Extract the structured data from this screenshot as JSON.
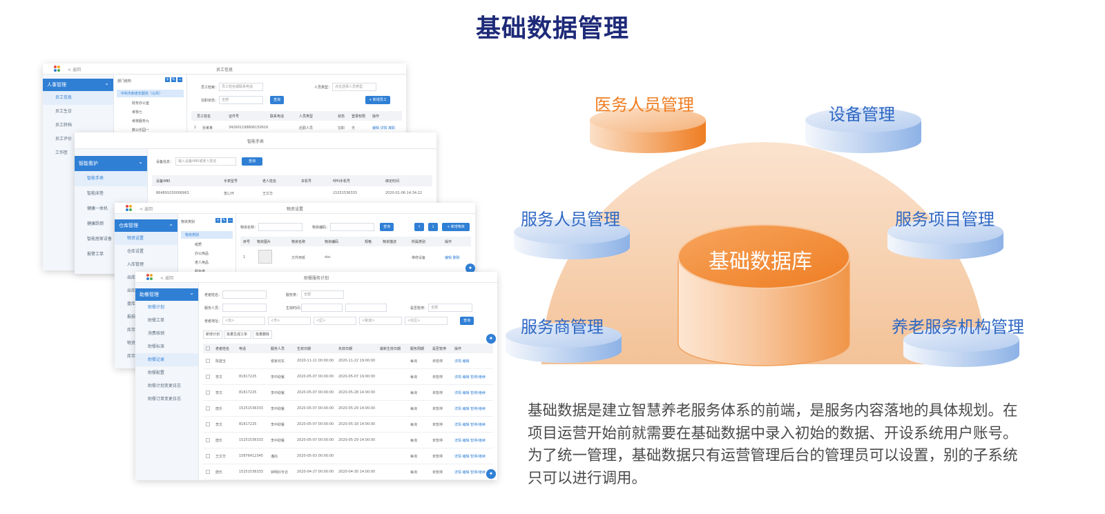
{
  "title": "基础数据管理",
  "description": "基础数据是建立智慧养老服务体系的前端，是服务内容落地的具体规划。在项目运营开始前就需要在基础数据中录入初始的数据、开设系统用户账号。为了统一管理，基础数据只有运营管理后台的管理员可以设置，别的子系统只可以进行调用。",
  "diagram": {
    "center": "基础数据库",
    "nodes": {
      "medical": "医务人员管理",
      "equipment": "设备管理",
      "service_staff": "服务人员管理",
      "service_project": "服务项目管理",
      "provider": "服务商管理",
      "institution": "养老服务机构管理"
    },
    "colors": {
      "orange": "#ee7d22",
      "blue": "#2f68c4",
      "dome": "#f6c9a0"
    }
  },
  "screens": {
    "staff": {
      "back": "返回",
      "title": "员工信息",
      "side_head": "人事管理",
      "side_items": [
        "员工信息",
        "员工生日",
        "员工转档",
        "员工评价",
        "工作医"
      ],
      "tree_head": "部门结构",
      "tree_items": [
        "中科杰和老年服务（公共）",
        "财务办公室",
        "考核七",
        "考核服务九",
        "数公乐园一"
      ],
      "search_label": "员工检索：",
      "search_placeholder": "员工姓名或联系电话",
      "type_label": "人员类型：",
      "type_placeholder": "点击选择人员类型",
      "status_label": "在职状态：",
      "status_value": "全部",
      "query": "查询",
      "add": "+ 新增员工",
      "cols": [
        "员工姓名",
        "证件号",
        "联系电话",
        "人员类型",
        "状态",
        "登录权限",
        "操作"
      ],
      "row": [
        "1",
        "张某某",
        "342601198806150616",
        "",
        "后勤人员",
        "在职",
        "无",
        "编辑 详情 离职"
      ]
    },
    "wear": {
      "title": "智能手表",
      "side_head": "智能看护",
      "side_items": [
        "智能手表",
        "智能床垫",
        "健康一体机",
        "健康跌倒",
        "智能居家设备",
        "报警工单"
      ],
      "search_label": "设备信息：",
      "search_placeholder": "输入设备IMEI或老人姓名",
      "query": "查询",
      "cols": [
        "设备IMEI",
        "手表型号",
        "老人姓名",
        "本机号",
        "呼叫手机号",
        "绑定时间"
      ],
      "row": [
        "864891030006963",
        "衷心环",
        "王文华",
        "",
        "15251536333",
        "2020-01-06 14:34:22"
      ]
    },
    "goods": {
      "back": "返回",
      "title": "物资设置",
      "side_head": "仓库管理",
      "side_items": [
        "物资设置",
        "仓库设置",
        "入库管理",
        "出库管理",
        "出库审核",
        "盘库管理",
        "报损管理",
        "库存统计",
        "物资盘点",
        "库存预警"
      ],
      "tree_head": "物资类别",
      "tree_items": [
        "物资类别",
        "纸质",
        "办公用品",
        "老人用品",
        "服务类"
      ],
      "name_label": "物资名称：",
      "code_label": "物资编码：",
      "query": "查询",
      "add": "+ 新增物资",
      "cols": [
        "序号",
        "物资图片",
        "物资名称",
        "物资编码",
        "规格",
        "物资描述",
        "所属类别",
        "操作"
      ],
      "row": [
        "1",
        "",
        "文件用纸",
        "doc",
        "",
        "",
        "维修设备",
        "编辑 删除"
      ]
    },
    "assist": {
      "back": "返回",
      "title": "助餐服务计划",
      "side_head": "助餐管理",
      "side_items": [
        "助餐计划",
        "助餐工单",
        "消费核销",
        "助餐标准",
        "助餐记录",
        "助餐配置",
        "助餐计划变更日志",
        "助餐订单变更日志"
      ],
      "f_name": "老者姓名：",
      "f_type": "服务类：",
      "f_type_value": "全部",
      "f_staff": "服务人员：",
      "f_time": "生效时间：",
      "f_pause": "是否暂停：",
      "f_pause_value": "全部",
      "f_address": "老者地址：",
      "addr_selects": [
        "<省>",
        "<市>",
        "<区>",
        "<街道>",
        "<社区>"
      ],
      "query": "查询",
      "actions": [
        "新增计划",
        "批量生成工单",
        "批量删除"
      ],
      "cols": [
        "老者姓名",
        "电话",
        "服务人员",
        "生效日期",
        "失效日期",
        "最新生效日期",
        "服务周期",
        "是否暂停",
        "操作"
      ],
      "rows": [
        [
          "陈建玉",
          "",
          "谢家坊东",
          "2020-11-11 00:00:00",
          "2020-11-22 19:00:00",
          "",
          "每询",
          "未暂停",
          "详情 编辑"
        ],
        [
          "李文",
          "81817225",
          "李中助餐",
          "2020-05-07 00:00:00",
          "2020-05-07 19:00:00",
          "",
          "每询",
          "未暂停",
          "详情 编辑 暂停/继续"
        ],
        [
          "李文",
          "81817225",
          "李中助餐",
          "2020-05-07 00:00:00",
          "2020-05-28 14:00:00",
          "",
          "每询",
          "未暂停",
          "详情 编辑 暂停/继续"
        ],
        [
          "唐乐",
          "15251536333",
          "李中助餐",
          "2020-05-07 00:00:00",
          "2020-05-29 14:00:00",
          "",
          "每询",
          "未暂停",
          "详情 编辑 暂停/继续"
        ],
        [
          "李文",
          "81817225",
          "李中助餐",
          "2020-05-07 00:00:00",
          "2020-05-18 14:00:00",
          "",
          "每询",
          "未暂停",
          "详情 编辑 暂停/继续"
        ],
        [
          "唐乐",
          "15251536333",
          "李中助餐",
          "2020-05-07 00:00:00",
          "2020-05-29 14:00:00",
          "",
          "每询",
          "未暂停",
          "详情 编辑 暂停/继续"
        ],
        [
          "王文华",
          "15876412345",
          "潘尚",
          "2020-05-03 00:00:00",
          "",
          "",
          "每询",
          "未暂停",
          "详情 编辑 暂停/继续"
        ],
        [
          "唐乐",
          "15251536333",
          "钟明红专访",
          "2020-04-27 00:00:00",
          "2020-04-30 14:00:00",
          "",
          "每询",
          "未暂停",
          "详情 编辑 暂停/继续"
        ]
      ]
    }
  }
}
